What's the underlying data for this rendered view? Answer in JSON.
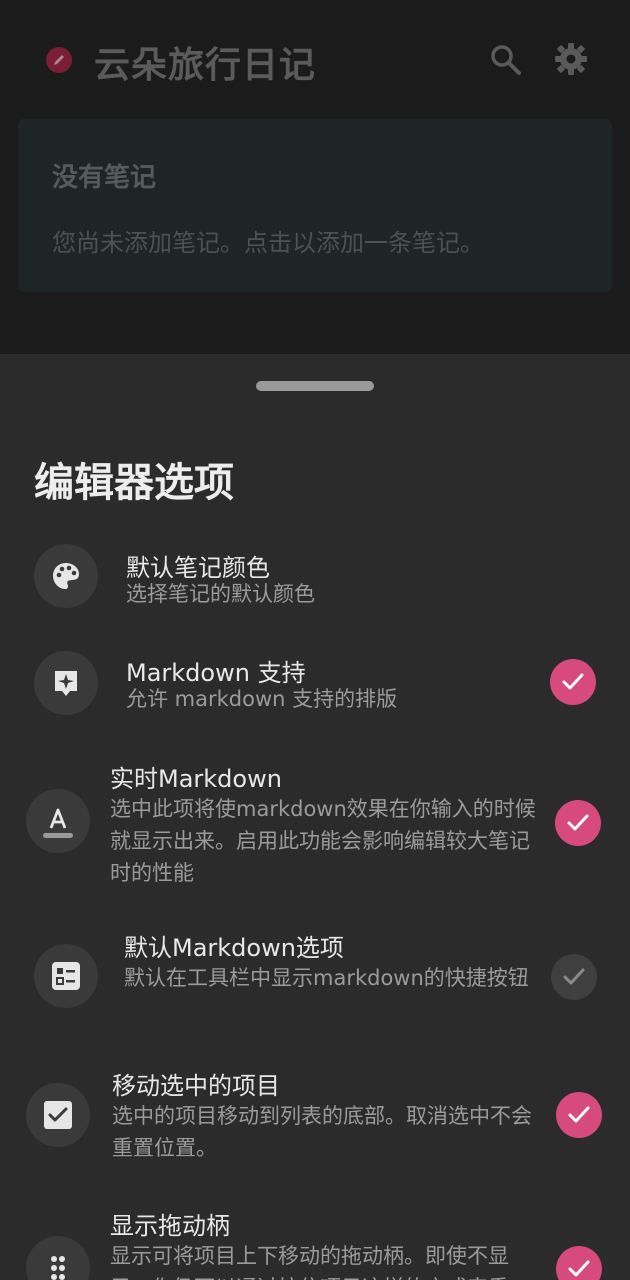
{
  "app": {
    "title": "云朵旅行日记",
    "icons": {
      "logo": "pencil-icon",
      "search": "search-icon",
      "settings": "gear-icon"
    }
  },
  "empty_note": {
    "title": "没有笔记",
    "message": "您尚未添加笔记。点击以添加一条笔记。"
  },
  "sheet": {
    "title": "编辑器选项",
    "items": [
      {
        "title": "默认笔记颜色",
        "subtitle": "选择笔记的默认颜色",
        "icon": "palette-icon",
        "checked": null
      },
      {
        "title": "Markdown 支持",
        "subtitle": "允许 markdown 支持的排版",
        "icon": "sparkle-note-icon",
        "checked": true
      },
      {
        "title": "实时Markdown",
        "subtitle": "选中此项将使markdown效果在你输入的时候就显示出来。启用此功能会影响编辑较大笔记时的性能",
        "icon": "text-format-icon",
        "checked": true
      },
      {
        "title": "默认Markdown选项",
        "subtitle": "默认在工具栏中显示markdown的快捷按钮",
        "icon": "checklist-icon",
        "checked": false
      },
      {
        "title": "移动选中的项目",
        "subtitle": "选中的项目移动到列表的底部。取消选中不会重置位置。",
        "icon": "checkbox-icon",
        "checked": true
      },
      {
        "title": "显示拖动柄",
        "subtitle": "显示可将项目上下移动的拖动柄。即使不显示，你仍可以通过按住项目这样的方式来重",
        "icon": "drag-handle-icon",
        "checked": true
      }
    ]
  },
  "colors": {
    "accent": "#d64a7c",
    "sheet_bg": "#2b2b2b",
    "icon_bg": "#3a3a3a"
  }
}
